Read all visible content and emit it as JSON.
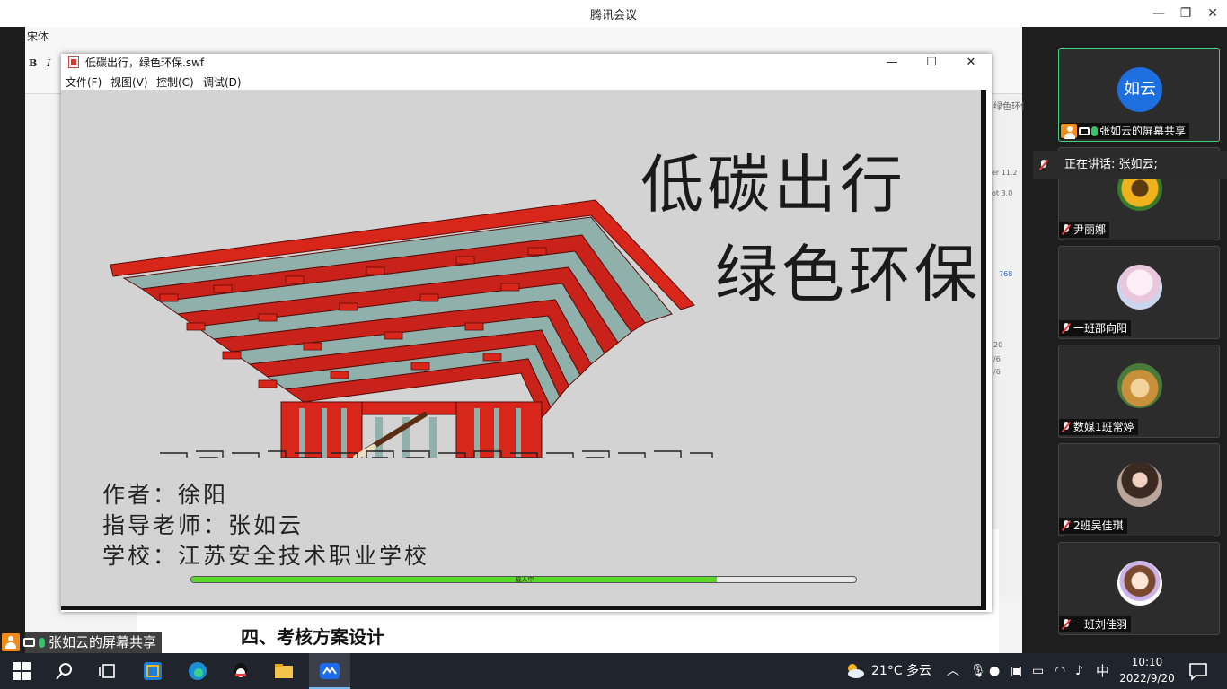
{
  "meeting": {
    "title": "腾讯会议",
    "minimize": "—",
    "restore": "❐",
    "close": "✕"
  },
  "word_bg": {
    "font_name": "宋体",
    "bold": "B",
    "italic": "I",
    "heading": "四、考核方案设计",
    "panel_texts": [
      "绿色环保",
      "er 11.2",
      "ot 3.0",
      "768",
      "20",
      "/6",
      "/6"
    ]
  },
  "swf": {
    "title": "低碳出行，绿色环保.swf",
    "minimize": "—",
    "maximize": "☐",
    "close": "✕",
    "menus": [
      "文件(F)",
      "视图(V)",
      "控制(C)",
      "调试(D)"
    ],
    "slogan_line1": "低碳出行",
    "slogan_line2": "绿色环保",
    "credit_author": "作者：徐阳",
    "credit_advisor": "指导老师：张如云",
    "credit_school": "学校：江苏安全技术职业学校",
    "progress_label": "载入中",
    "progress_fraction": 0.79
  },
  "share_tag": {
    "label": "张如云的屏幕共享"
  },
  "panel": {
    "speaking": "正在讲话: 张如云;",
    "participants": [
      {
        "name": "张如云的屏幕共享",
        "avatar_text": "如云",
        "avatar_color": "#1d6fe0",
        "kind": "text",
        "active": true
      },
      {
        "name": "尹丽娜",
        "avatar_color": "#e9a31a",
        "kind": "sunflower",
        "active": false
      },
      {
        "name": "一班邵向阳",
        "avatar_color": "#f1d6e6",
        "kind": "anime",
        "active": false
      },
      {
        "name": "数媒1班常婷",
        "avatar_color": "#c8a05a",
        "kind": "cartoon",
        "active": false
      },
      {
        "name": "2班吴佳琪",
        "avatar_color": "#a58c7a",
        "kind": "photo",
        "active": false
      },
      {
        "name": "一班刘佳羽",
        "avatar_color": "#f4ecf6",
        "kind": "girl",
        "active": false
      }
    ]
  },
  "taskbar": {
    "weather": "21°C 多云",
    "ime": "中",
    "time": "10:10",
    "date": "2022/9/20"
  }
}
